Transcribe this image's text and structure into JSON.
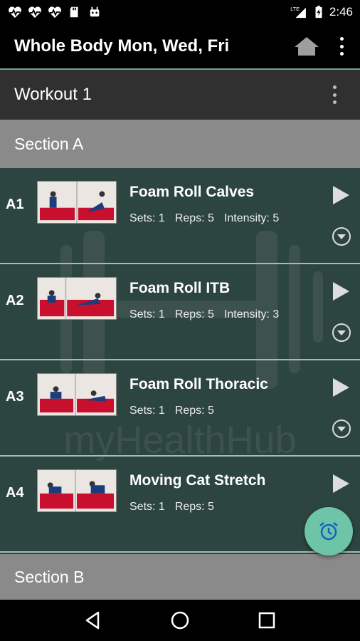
{
  "status_bar": {
    "left_icons": [
      "heart-pulse-icon",
      "heart-pulse-icon",
      "heart-pulse-icon",
      "sd-card-icon",
      "android-icon"
    ],
    "network_label": "LTE",
    "time": "2:46"
  },
  "app_bar": {
    "title": "Whole Body Mon, Wed, Fri"
  },
  "workout": {
    "title": "Workout 1"
  },
  "sections": [
    {
      "title": "Section A",
      "exercises": [
        {
          "code": "A1",
          "name": "Foam Roll Calves",
          "sets": "Sets: 1",
          "reps": "Reps: 5",
          "intensity": "Intensity: 5"
        },
        {
          "code": "A2",
          "name": "Foam Roll ITB",
          "sets": "Sets: 1",
          "reps": "Reps: 5",
          "intensity": "Intensity: 3"
        },
        {
          "code": "A3",
          "name": "Foam Roll Thoracic",
          "sets": "Sets: 1",
          "reps": "Reps: 5"
        },
        {
          "code": "A4",
          "name": "Moving Cat Stretch",
          "sets": "Sets: 1",
          "reps": "Reps: 5"
        }
      ]
    },
    {
      "title": "Section B"
    }
  ],
  "watermark": "myHealthHub",
  "colors": {
    "accent": "#6dc4a7",
    "list_background": "#2d4540",
    "section_header": "#8a8a8a",
    "workout_header": "#303030"
  }
}
